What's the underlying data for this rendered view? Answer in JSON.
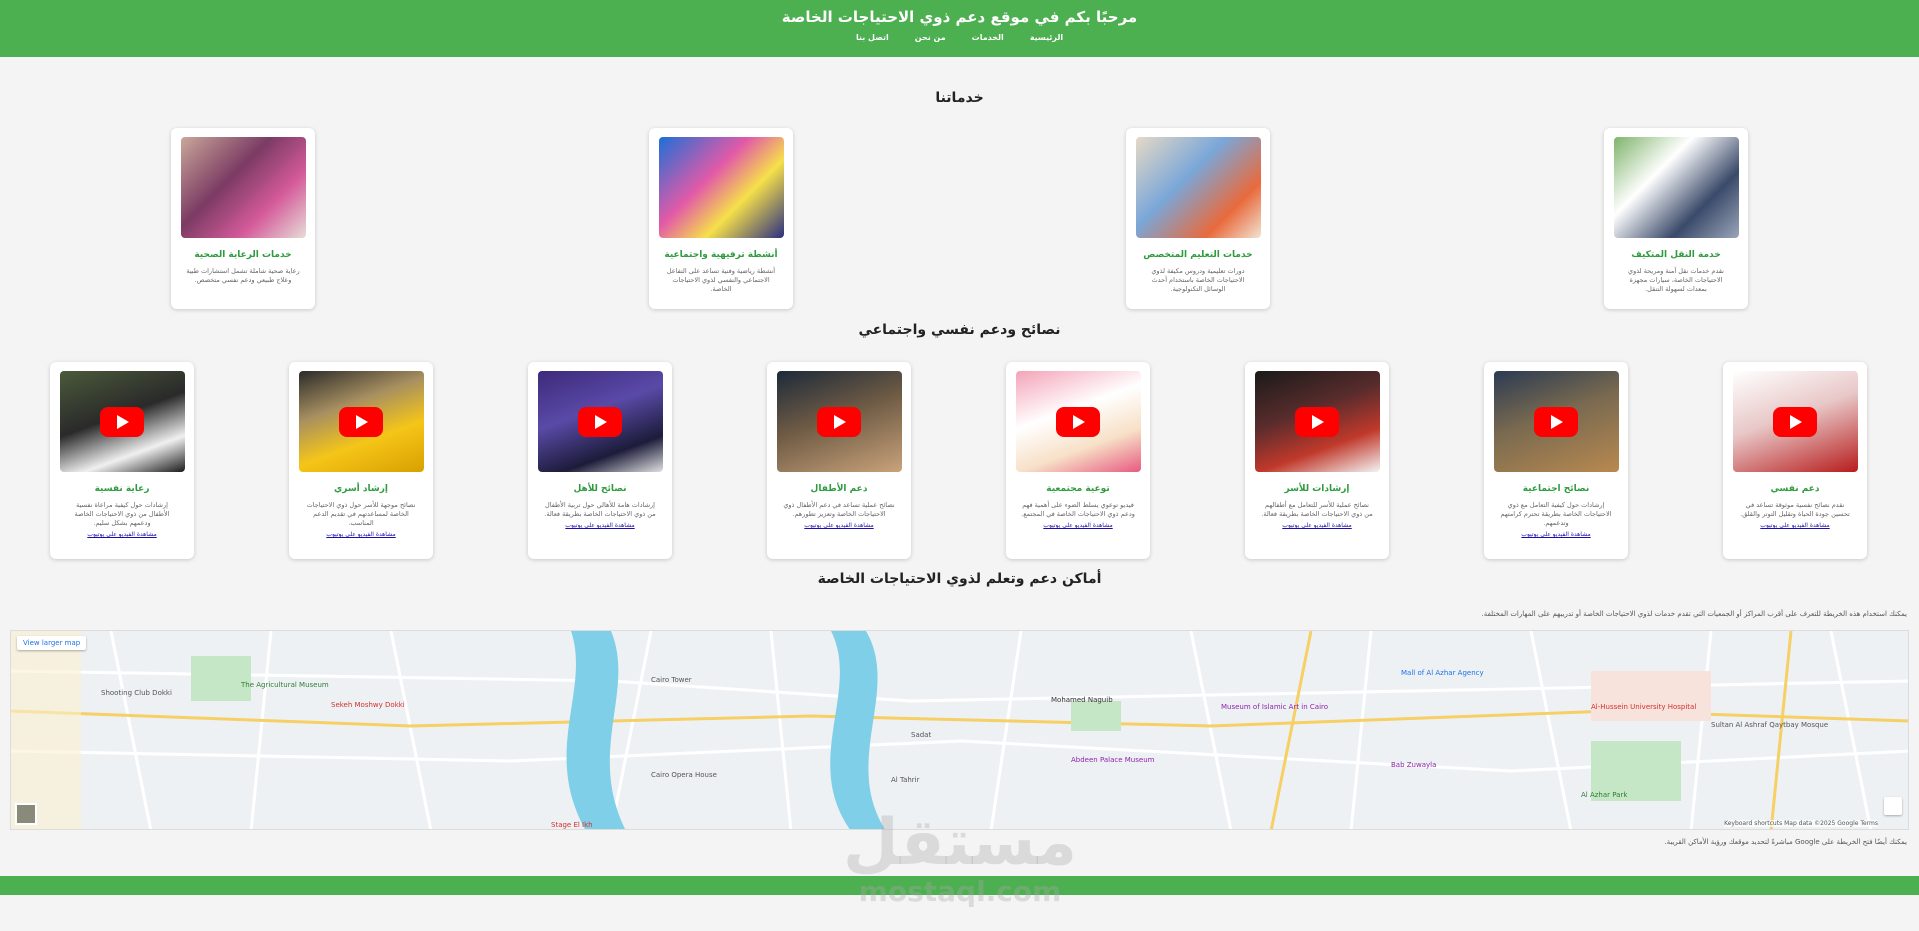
{
  "header": {
    "title": "مرحبًا بكم في موقع دعم ذوي الاحتياجات الخاصة",
    "nav": [
      "الرئيسية",
      "الخدمات",
      "من نحن",
      "اتصل بنا"
    ]
  },
  "services": {
    "title": "خدماتنا",
    "cards": [
      {
        "title": "خدمة النقل المتكيف",
        "desc": "نقدم خدمات نقل آمنة ومريحة لذوي الاحتياجات الخاصة، سيارات مجهزة بمعدات لسهولة التنقل."
      },
      {
        "title": "خدمات التعليم المتخصص",
        "desc": "دورات تعليمية ودروس مكيفة لذوي الاحتياجات الخاصة باستخدام أحدث الوسائل التكنولوجية."
      },
      {
        "title": "أنشطة ترفيهية واجتماعية",
        "desc": "أنشطة رياضية وفنية تساعد على التفاعل الاجتماعي والنفسي لذوي الاحتياجات الخاصة."
      },
      {
        "title": "خدمات الرعاية الصحية",
        "desc": "رعاية صحية شاملة تشمل استشارات طبية وعلاج طبيعي ودعم نفسي متخصص."
      }
    ]
  },
  "tips": {
    "title": "نصائح ودعم نفسي واجتماعي",
    "link": "مشاهدة الفيديو على يوتيوب",
    "cards": [
      {
        "title": "دعم نفسي",
        "desc": "نقدم نصائح نفسية موثوقة تساعد في تحسين جودة الحياة وتقليل التوتر والقلق."
      },
      {
        "title": "نصائح اجتماعية",
        "desc": "إرشادات حول كيفية التعامل مع ذوي الاحتياجات الخاصة بطريقة تحترم كرامتهم وتدعمهم."
      },
      {
        "title": "إرشادات للأسر",
        "desc": "نصائح عملية للأسر للتعامل مع أطفالهم من ذوي الاحتياجات الخاصة بطريقة فعالة."
      },
      {
        "title": "توعية مجتمعية",
        "desc": "فيديو توعوي يسلط الضوء على أهمية فهم ودعم ذوي الاحتياجات الخاصة في المجتمع."
      },
      {
        "title": "دعم الأطفال",
        "desc": "نصائح عملية تساعد في دعم الأطفال ذوي الاحتياجات الخاصة وتعزيز تطورهم."
      },
      {
        "title": "نصائح للأهل",
        "desc": "إرشادات هامة للأهالي حول تربية الأطفال من ذوي الاحتياجات الخاصة بطريقة فعالة."
      },
      {
        "title": "إرشاد أسري",
        "desc": "نصائح موجهة للأسر حول ذوي الاحتياجات الخاصة لمساعدتهم في تقديم الدعم المناسب."
      },
      {
        "title": "رعاية نفسية",
        "desc": "إرشادات حول كيفية مراعاة نفسية الأطفال من ذوي الاحتياجات الخاصة ودعمهم بشكل سليم."
      }
    ]
  },
  "places": {
    "title": "أماكن دعم وتعلم لذوي الاحتياجات الخاصة",
    "intro": "يمكنك استخدام هذه الخريطة للتعرف على أقرب المراكز أو الجمعيات التي تقدم خدمات لذوي الاحتياجات الخاصة أو تدريبهم على المهارات المختلفة.",
    "map_button": "View larger map",
    "bottom_note": "يمكنك أيضًا فتح الخريطة على Google مباشرةً لتحديد موقعك ورؤية الأماكن القريبة.",
    "map_labels": [
      "The Agricultural Museum",
      "Cairo Tower",
      "Mohamed Naguib",
      "Museum of Islamic Art in Cairo",
      "Mall of Al Azhar Agency",
      "Al-Hussein University Hospital",
      "Al Azhar Park",
      "Cairo Opera House",
      "Abdeen Palace Museum",
      "Shooting Club Dokki",
      "Sultan Al Ashraf Qaytbay Mosque",
      "Sekeh Moshwy Dokki",
      "Al Tahrir",
      "Bab Zuwayla",
      "Sadat",
      "Stage El Ikh"
    ],
    "map_footer": "Keyboard shortcuts  Map data ©2025 Google  Terms"
  },
  "watermark": {
    "ar": "مستقل",
    "en": "mostaql.com"
  },
  "colors": {
    "brand": "#4caf50",
    "card_title": "#2e9c3e",
    "link": "#1a0dab"
  }
}
